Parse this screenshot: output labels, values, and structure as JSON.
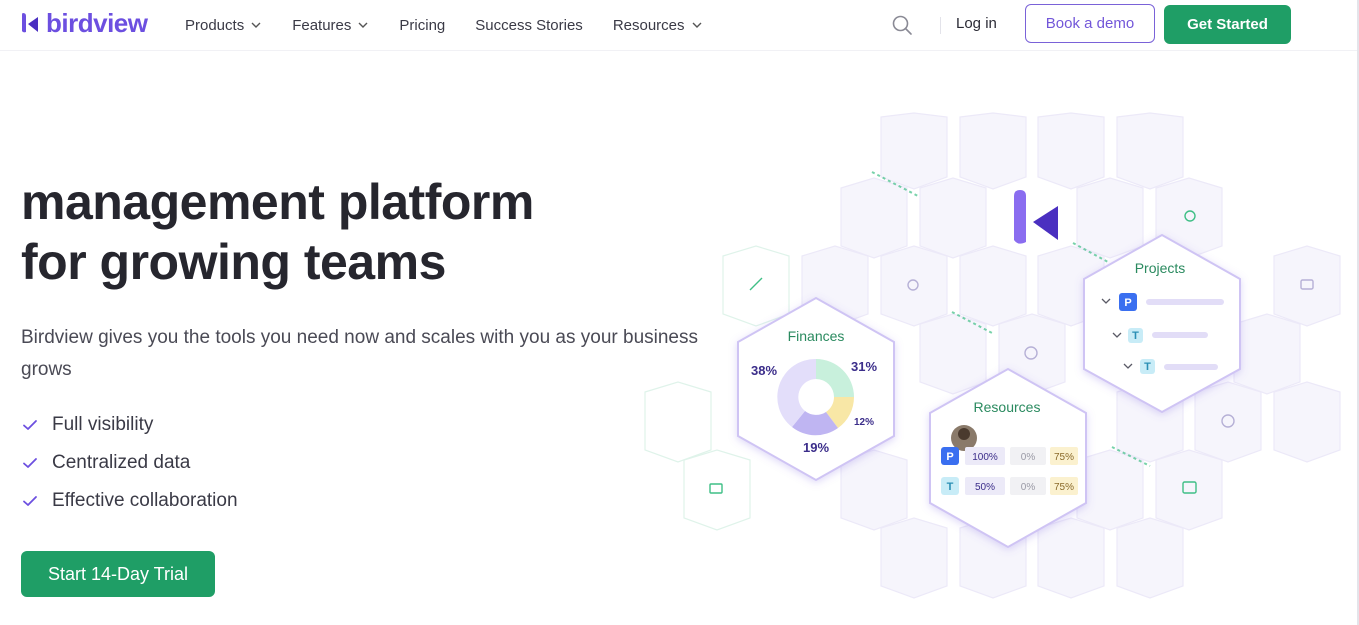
{
  "brand": {
    "name": "birdview",
    "color": "#6c4fe0"
  },
  "nav": {
    "products": "Products",
    "features": "Features",
    "pricing": "Pricing",
    "success_stories": "Success Stories",
    "resources": "Resources"
  },
  "header": {
    "login": "Log in",
    "book_demo": "Book a demo",
    "get_started": "Get Started"
  },
  "hero": {
    "title_line1": "management platform",
    "title_line2": "for growing teams",
    "subtitle": "Birdview gives you the tools you need now and scales with you as your business grows",
    "checks": [
      "Full visibility",
      "Centralized data",
      "Effective collaboration"
    ],
    "cta": "Start 14-Day Trial"
  },
  "illustration": {
    "finances": {
      "label": "Finances",
      "slices": [
        "38%",
        "31%",
        "12%",
        "19%"
      ]
    },
    "projects": {
      "label": "Projects",
      "rows": [
        "P",
        "T",
        "T"
      ]
    },
    "resources": {
      "label": "Resources",
      "rows": [
        {
          "letter": "P",
          "a": "100%",
          "b": "0%",
          "c": "75%"
        },
        {
          "letter": "T",
          "a": "50%",
          "b": "0%",
          "c": "75%"
        }
      ]
    }
  },
  "colors": {
    "accent": "#6c4fe0",
    "green": "#1f9e66",
    "pie_green": "#c8f0dc",
    "pie_yellow": "#f8e7a6",
    "pie_purple": "#cfc7f5"
  }
}
